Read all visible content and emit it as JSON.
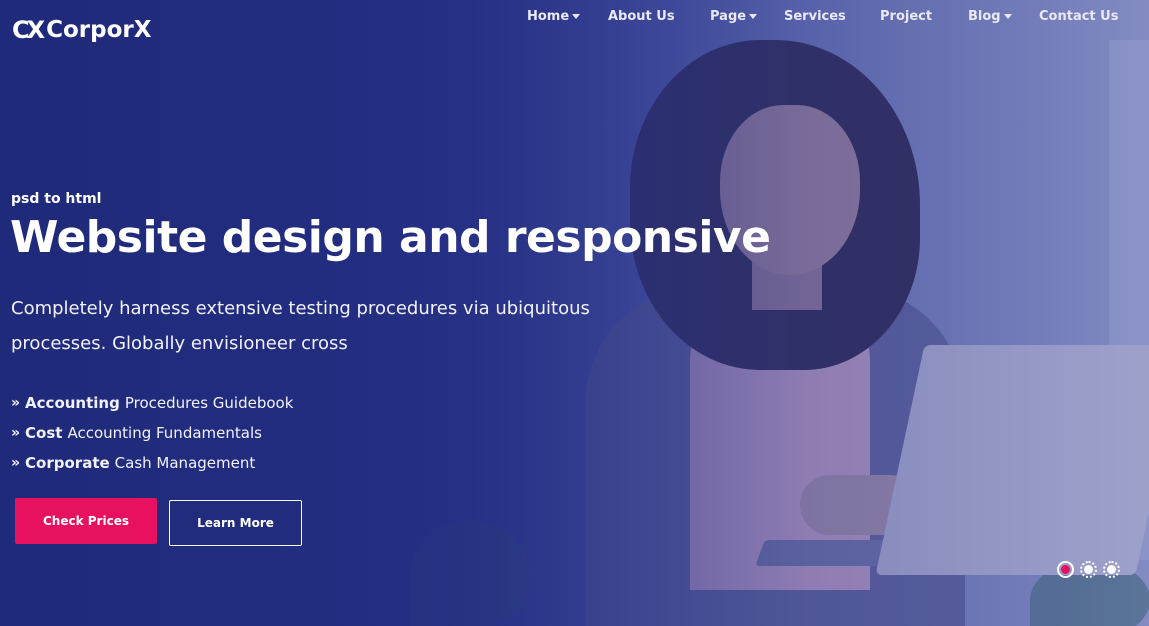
{
  "brand": {
    "mark": "CX",
    "name": "CorporX"
  },
  "nav": {
    "items": [
      {
        "label": "Home",
        "dropdown": true
      },
      {
        "label": "About Us",
        "dropdown": false
      },
      {
        "label": "Page",
        "dropdown": true
      },
      {
        "label": "Services",
        "dropdown": false
      },
      {
        "label": "Project",
        "dropdown": false
      },
      {
        "label": "Blog",
        "dropdown": true
      },
      {
        "label": "Contact Us",
        "dropdown": false
      }
    ]
  },
  "hero": {
    "eyebrow": "psd to html",
    "headline": "Website design and responsive",
    "description": "Completely harness extensive testing procedures via ubiquitous processes. Globally envisioneer cross",
    "features": [
      {
        "strong": "Accounting",
        "text": "Procedures Guidebook"
      },
      {
        "strong": "Cost",
        "text": "Accounting Fundamentals"
      },
      {
        "strong": "Corporate",
        "text": "Cash Management"
      }
    ],
    "primary_button": "Check Prices",
    "secondary_button": "Learn More"
  },
  "slider": {
    "slides": 3,
    "active_index": 0
  },
  "colors": {
    "accent": "#e8115f",
    "hero_bg": "#1f2a7a"
  }
}
